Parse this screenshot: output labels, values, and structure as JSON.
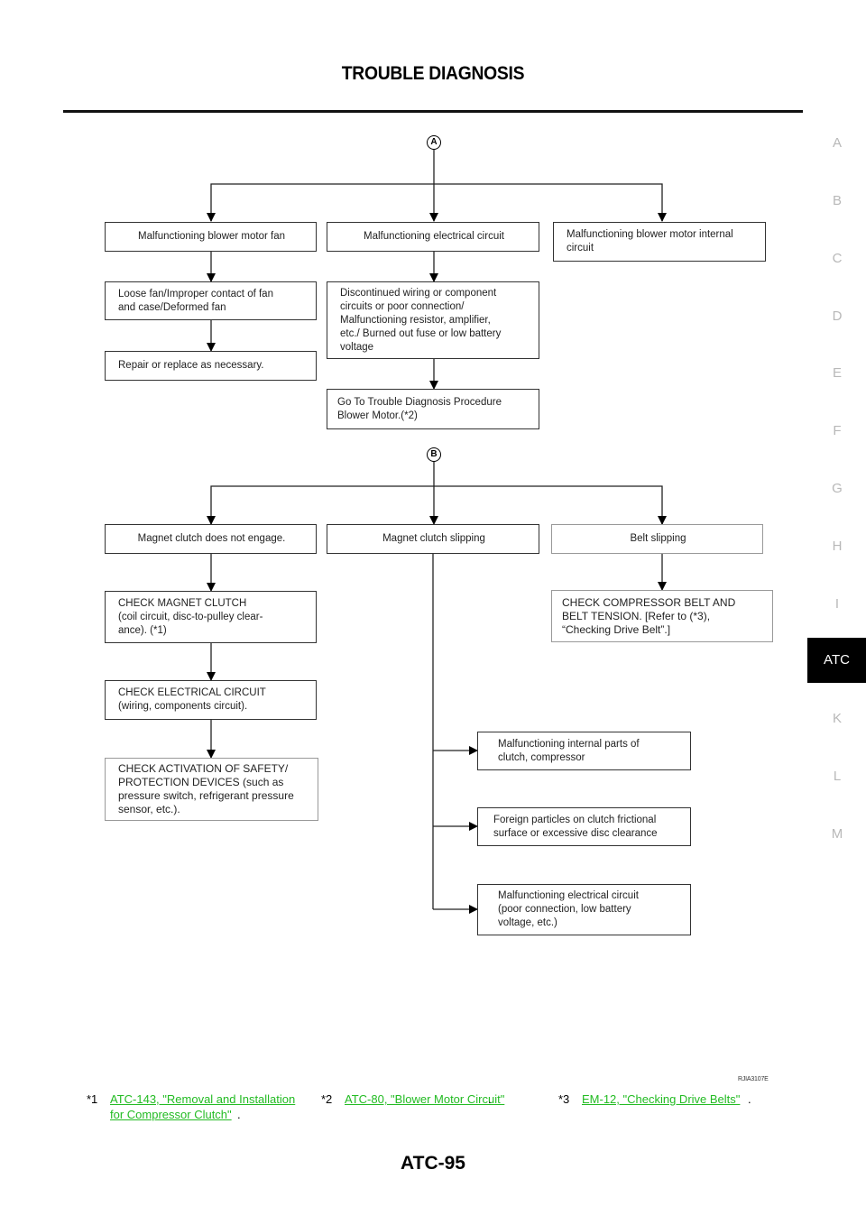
{
  "header": {
    "title": "TROUBLE DIAGNOSIS"
  },
  "side_index": {
    "tabs": [
      "A",
      "B",
      "C",
      "D",
      "E",
      "F",
      "G",
      "H",
      "I",
      "ATC",
      "K",
      "L",
      "M"
    ],
    "active": "ATC"
  },
  "flowchart": {
    "section_a": {
      "connector": "A",
      "branches": {
        "blower_fan": {
          "symptom": "Malfunctioning blower motor fan",
          "cause": "Loose fan/Improper contact of fan\nand case/Deformed fan",
          "action": "Repair or replace as necessary."
        },
        "electrical": {
          "symptom": "Malfunctioning electrical circuit",
          "cause": "Discontinued wiring or component\ncircuits or poor connection/\nMalfunctioning resistor, amplifier,\netc./ Burned out fuse or low battery\nvoltage",
          "action": "Go To Trouble Diagnosis Procedure\nBlower Motor.(*2)"
        },
        "internal": {
          "symptom": "Malfunctioning blower motor internal\ncircuit"
        }
      }
    },
    "section_b": {
      "connector": "B",
      "branches": {
        "not_engage": {
          "symptom": "Magnet clutch does not engage.",
          "step1": "CHECK MAGNET CLUTCH\n(coil circuit, disc-to-pulley clear-\nance). (*1)",
          "step2": "CHECK ELECTRICAL CIRCUIT\n(wiring, components circuit).",
          "step3": "CHECK ACTIVATION OF SAFETY/\nPROTECTION DEVICES (such as\npressure switch, refrigerant pressure\nsensor, etc.)."
        },
        "slipping": {
          "symptom": "Magnet clutch slipping",
          "causes": [
            "Malfunctioning internal parts of\nclutch, compressor",
            "Foreign particles on clutch frictional\nsurface or excessive disc clearance",
            "Malfunctioning electrical circuit\n(poor connection, low battery\nvoltage, etc.)"
          ]
        },
        "belt": {
          "symptom": "Belt slipping",
          "action": "CHECK COMPRESSOR BELT AND\nBELT TENSION. [Refer to (*3),\n“Checking Drive Belt”.]"
        }
      }
    }
  },
  "figure_code": "RJIA3107E",
  "footnotes": [
    {
      "num": "*1",
      "link": "ATC-143, \"Removal and Installation \nfor Compressor Clutch\"",
      "end": "."
    },
    {
      "num": "*2",
      "link": "ATC-80, \"Blower Motor Circuit\"",
      "end": "."
    },
    {
      "num": "*3",
      "link": "EM-12, \"Checking Drive Belts\"",
      "end": "."
    }
  ],
  "footer": {
    "page_number": "ATC-95"
  },
  "colors": {
    "link": "#22bb22",
    "active_tab_bg": "#000000",
    "inactive_tab_text": "#b8b8b8"
  }
}
